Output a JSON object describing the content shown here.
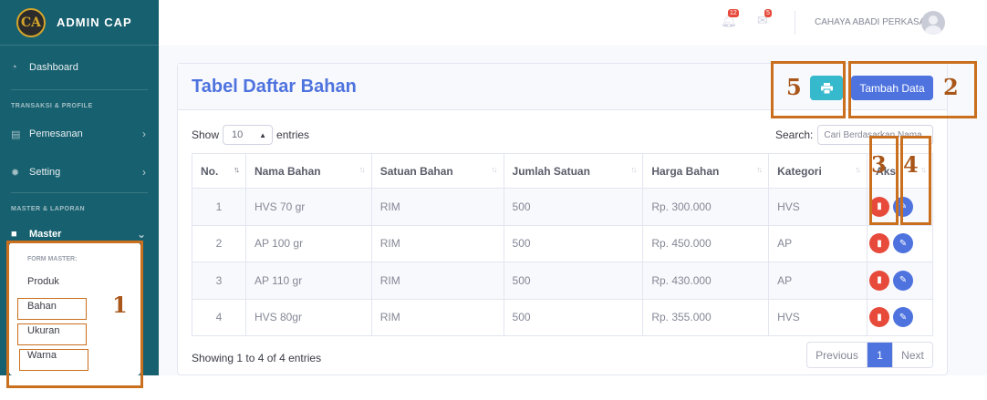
{
  "brand": {
    "logo_text": "CA",
    "name": "ADMIN CAP"
  },
  "sidebar": {
    "dashboard": "Dashboard",
    "heading_transaksi": "TRANSAKSI & PROFILE",
    "pemesanan": "Pemesanan",
    "setting": "Setting",
    "heading_master": "MASTER & LAPORAN",
    "master": "Master",
    "submenu": {
      "heading": "FORM MASTER:",
      "items": [
        "Produk",
        "Bahan",
        "Ukuran",
        "Warna"
      ]
    }
  },
  "topbar": {
    "alerts_count": "12",
    "messages_count": "5",
    "user_name": "CAHAYA ABADI PERKASA"
  },
  "card": {
    "title": "Tabel Daftar Bahan",
    "add_button": "Tambah Data",
    "print_icon": "print-icon"
  },
  "table_controls": {
    "show_label": "Show",
    "page_size": "10",
    "entries_label": "entries",
    "search_label": "Search:",
    "search_placeholder": "Cari Berdasarkan Nama"
  },
  "table": {
    "headers": [
      "No.",
      "Nama Bahan",
      "Satuan Bahan",
      "Jumlah Satuan",
      "Harga Bahan",
      "Kategori",
      "Aksi"
    ],
    "rows": [
      [
        "1",
        "HVS 70 gr",
        "RIM",
        "500",
        "Rp. 300.000",
        "HVS"
      ],
      [
        "2",
        "AP 100 gr",
        "RIM",
        "500",
        "Rp. 450.000",
        "AP"
      ],
      [
        "3",
        "AP 110 gr",
        "RIM",
        "500",
        "Rp. 430.000",
        "AP"
      ],
      [
        "4",
        "HVS 80gr",
        "RIM",
        "500",
        "Rp. 355.000",
        "HVS"
      ]
    ]
  },
  "footer": {
    "info": "Showing 1 to 4 of 4 entries",
    "prev": "Previous",
    "page": "1",
    "next": "Next"
  },
  "annotations": [
    "1",
    "2",
    "3",
    "4",
    "5"
  ],
  "colors": {
    "sidebar": "#17606f",
    "primary": "#4e73df",
    "info": "#36b9cc",
    "danger": "#e74a3b",
    "annotation": "#c96f1e"
  }
}
